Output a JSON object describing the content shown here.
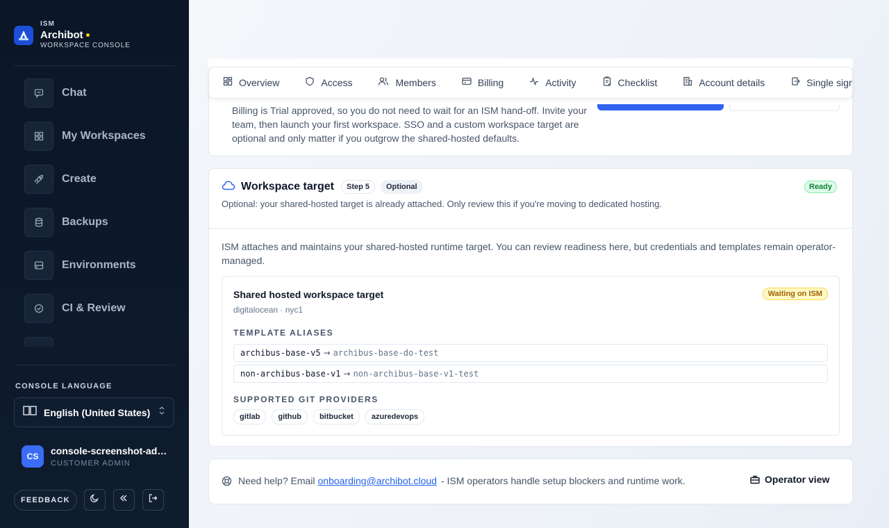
{
  "brand": {
    "kicker": "ISM",
    "name": "Archibot",
    "subtitle": "WORKSPACE CONSOLE",
    "accent_dot_color": "#facc15"
  },
  "sidebar": {
    "nav": [
      {
        "label": "Chat",
        "icon": "chat-icon"
      },
      {
        "label": "My Workspaces",
        "icon": "grid-icon"
      },
      {
        "label": "Create",
        "icon": "rocket-icon"
      },
      {
        "label": "Backups",
        "icon": "database-icon"
      },
      {
        "label": "Environments",
        "icon": "server-icon"
      },
      {
        "label": "CI & Review",
        "icon": "check-circle-icon"
      }
    ],
    "language_title": "CONSOLE LANGUAGE",
    "language_value": "English (United States)",
    "user": {
      "initials": "CS",
      "name": "console-screenshot-admin",
      "role": "CUSTOMER ADMIN"
    },
    "feedback_label": "FEEDBACK"
  },
  "tabs": [
    {
      "label": "Overview",
      "icon": "grid-icon"
    },
    {
      "label": "Access",
      "icon": "shield-icon"
    },
    {
      "label": "Members",
      "icon": "users-icon"
    },
    {
      "label": "Billing",
      "icon": "credit-card-icon"
    },
    {
      "label": "Activity",
      "icon": "activity-icon"
    },
    {
      "label": "Checklist",
      "icon": "clipboard-check-icon"
    },
    {
      "label": "Account details",
      "icon": "building-icon"
    },
    {
      "label": "Single sign-on",
      "icon": "sign-in-icon"
    }
  ],
  "billing_note": "Billing is Trial approved, so you do not need to wait for an ISM hand-off. Invite your team, then launch your first workspace. SSO and a custom workspace target are optional and only matter if you outgrow the shared-hosted defaults.",
  "workspace_target": {
    "title": "Workspace target",
    "step": "Step 5",
    "optional": "Optional",
    "status": "Ready",
    "subtitle": "Optional: your shared-hosted target is already attached. Only review this if you're moving to dedicated hosting.",
    "description": "ISM attaches and maintains your shared-hosted runtime target. You can review readiness here, but credentials and templates remain operator-managed.",
    "target": {
      "title": "Shared hosted workspace target",
      "meta": "digitalocean · nyc1",
      "status": "Waiting on ISM",
      "aliases_label": "TEMPLATE ALIASES",
      "aliases": [
        {
          "key": "archibus-base-v5",
          "value": "archibus-base-do-test"
        },
        {
          "key": "non-archibus-base-v1",
          "value": "non-archibus-base-v1-test"
        }
      ],
      "arrow": "→",
      "providers_label": "SUPPORTED GIT PROVIDERS",
      "providers": [
        "gitlab",
        "github",
        "bitbucket",
        "azuredevops"
      ]
    }
  },
  "help": {
    "prefix": "Need help? Email",
    "email": "onboarding@archibot.cloud",
    "suffix": "- ISM operators handle setup blockers and runtime work.",
    "operator_label": "Operator view"
  },
  "colors": {
    "primary": "#2f63f0",
    "ready": "#15803d",
    "waiting": "#a16207",
    "link": "#2563eb"
  }
}
